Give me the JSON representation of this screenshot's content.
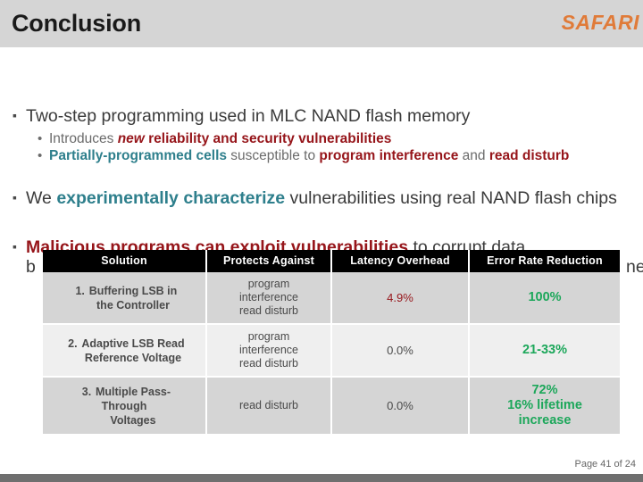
{
  "header": {
    "title": "Conclusion",
    "logo": "SAFARI",
    "logo_color": "#e07b39",
    "bar_color": "#d5d5d5"
  },
  "bullets": [
    {
      "marker": "icon-square-bullet",
      "text": "Two-step programming used in MLC NAND flash memory",
      "sub": [
        {
          "marker": "icon-round-bullet",
          "runs": [
            {
              "text": "Introduces ",
              "style": "gray"
            },
            {
              "text": "new",
              "style": "red-italic"
            },
            {
              "text": " reliability and security vulnerabilities",
              "style": "red"
            }
          ]
        },
        {
          "marker": "icon-round-bullet",
          "runs": [
            {
              "text": "Partially-programmed cells",
              "style": "teal"
            },
            {
              "text": " susceptible to ",
              "style": "gray"
            },
            {
              "text": "program interference",
              "style": "red"
            },
            {
              "text": " and ",
              "style": "gray"
            },
            {
              "text": "read disturb",
              "style": "red"
            }
          ]
        }
      ]
    },
    {
      "marker": "icon-square-bullet",
      "runs": [
        {
          "text": "We ",
          "style": "dkgray"
        },
        {
          "text": "experimentally characterize",
          "style": "teal"
        },
        {
          "text": " vulnerabilities using real NAND flash chips",
          "style": "dkgray"
        }
      ]
    },
    {
      "marker": "icon-square-bullet",
      "runs": [
        {
          "text": "Malicious programs can exploit vulnerabilities",
          "style": "red"
        },
        {
          "text": " to corrupt data",
          "style": "dkgray"
        }
      ],
      "occluded_line": {
        "left_fragment": "b",
        "right_fragment": "ne"
      }
    }
  ],
  "table": {
    "columns": [
      "Solution",
      "Protects Against",
      "Latency Overhead",
      "Error Rate Reduction"
    ],
    "rows": [
      {
        "number": "1.",
        "solution_line1": "Buffering LSB in",
        "solution_line2": "the Controller",
        "protects": [
          "program",
          "interference",
          "read disturb"
        ],
        "latency": "4.9%",
        "latency_color": "#96151a",
        "error": [
          "100%"
        ],
        "error_color": "#1ca75a"
      },
      {
        "number": "2.",
        "solution_line1": "Adaptive LSB Read",
        "solution_line2": "Reference Voltage",
        "protects": [
          "program",
          "interference",
          "read disturb"
        ],
        "latency": "0.0%",
        "latency_color": "#4a4a4a",
        "error": [
          "21-33%"
        ],
        "error_color": "#1ca75a"
      },
      {
        "number": "3.",
        "solution_line1": "Multiple Pass-",
        "solution_line2": "Through",
        "solution_line3": "Voltages",
        "protects": [
          "read disturb"
        ],
        "latency": "0.0%",
        "latency_color": "#4a4a4a",
        "error": [
          "72%",
          "16% lifetime",
          "increase"
        ],
        "error_color": "#1ca75a"
      }
    ]
  },
  "footer": {
    "page_label": "Page 41 of 24",
    "bar_color": "#6f6f6f"
  }
}
